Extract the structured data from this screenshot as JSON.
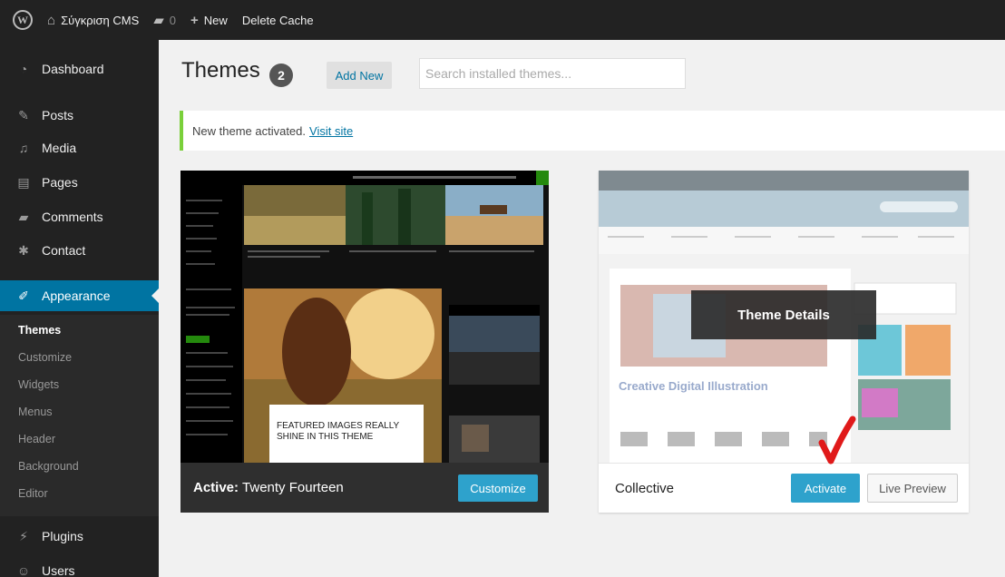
{
  "adminbar": {
    "site_name": "Σύγκριση CMS",
    "comments_count": "0",
    "new_label": "New",
    "delete_cache_label": "Delete Cache"
  },
  "sidebar": {
    "items": [
      {
        "label": "Dashboard",
        "icon": "dashboard-icon"
      },
      {
        "label": "Posts",
        "icon": "pin-icon"
      },
      {
        "label": "Media",
        "icon": "media-icon"
      },
      {
        "label": "Pages",
        "icon": "pages-icon"
      },
      {
        "label": "Comments",
        "icon": "comments-icon"
      },
      {
        "label": "Contact",
        "icon": "contact-icon"
      },
      {
        "label": "Appearance",
        "icon": "brush-icon"
      },
      {
        "label": "Plugins",
        "icon": "plug-icon"
      },
      {
        "label": "Users",
        "icon": "users-icon"
      }
    ],
    "submenu": [
      "Themes",
      "Customize",
      "Widgets",
      "Menus",
      "Header",
      "Background",
      "Editor"
    ]
  },
  "header": {
    "title": "Themes",
    "count": "2",
    "add_new_label": "Add New",
    "search_placeholder": "Search installed themes..."
  },
  "notice": {
    "text": "New theme activated.",
    "link_text": "Visit site"
  },
  "themes": {
    "active": {
      "prefix": "Active:",
      "name": "Twenty Fourteen",
      "customize_label": "Customize",
      "featured_text": "FEATURED IMAGES REALLY SHINE IN THIS THEME"
    },
    "collective": {
      "name": "Collective",
      "activate_label": "Activate",
      "live_preview_label": "Live Preview",
      "details_label": "Theme Details",
      "preview_heading": "Creative Digital Illustration"
    }
  },
  "colors": {
    "adminbar_bg": "#222222",
    "accent": "#0074a2",
    "button_primary": "#2ea2cc",
    "notice_border": "#7ad03a",
    "annotation_red": "#e01a1a"
  }
}
